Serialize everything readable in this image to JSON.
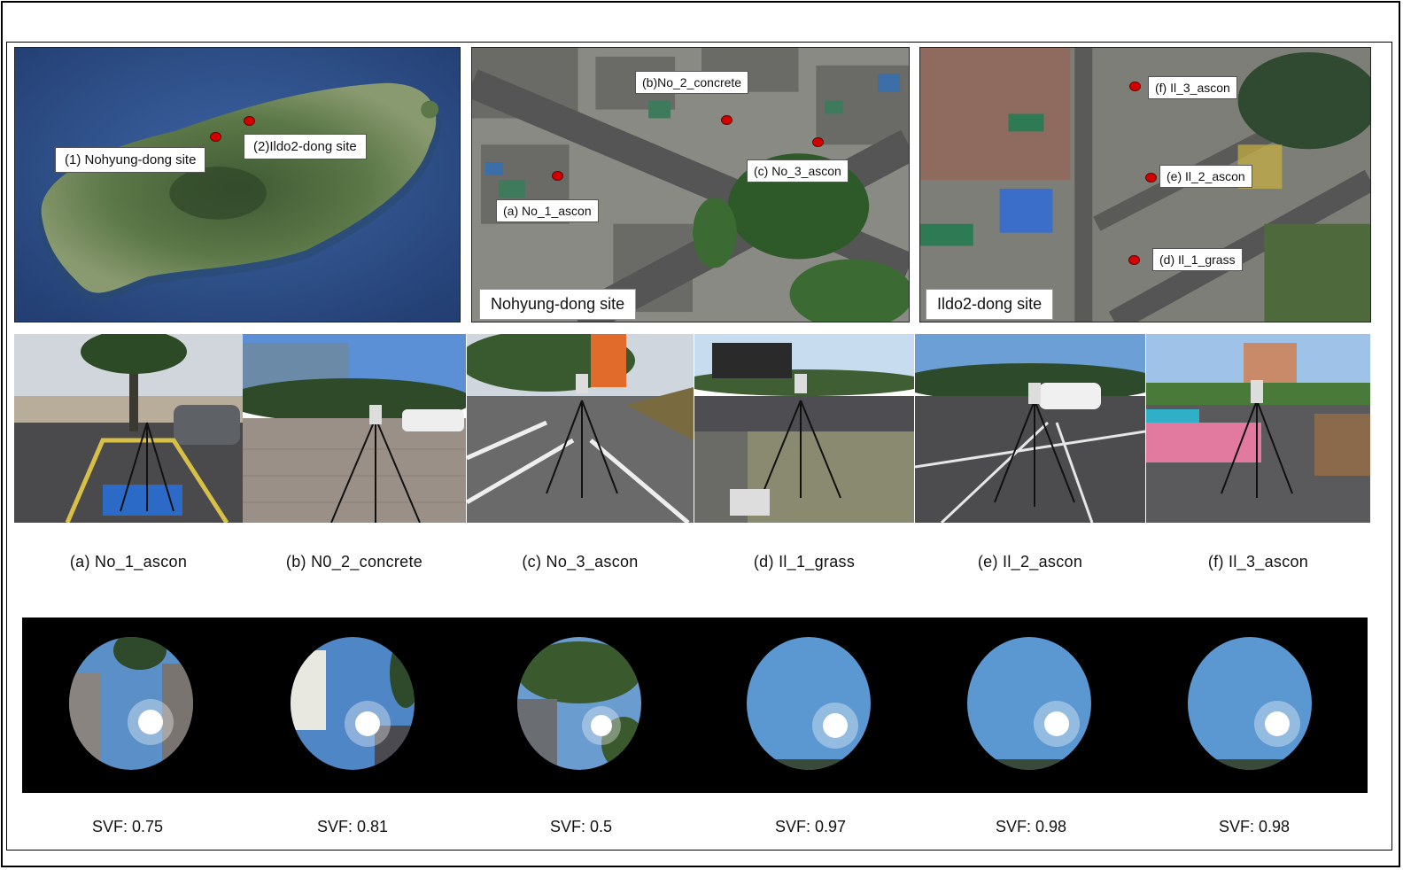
{
  "maps": {
    "island": {
      "label_1": "(1) Nohyung-dong site",
      "label_2": "(2)Ildo2-dong site"
    },
    "nohyung": {
      "site_label": "Nohyung-dong site",
      "labels": [
        "(a) No_1_ascon",
        "(b)No_2_concrete",
        "(c) No_3_ascon"
      ]
    },
    "ildo": {
      "site_label": "Ildo2-dong site",
      "labels": [
        "(d) Il_1_grass",
        "(e) Il_2_ascon",
        "(f) Il_3_ascon"
      ]
    }
  },
  "photos": {
    "captions": [
      "(a) No_1_ascon",
      "(b) N0_2_concrete",
      "(c) No_3_ascon",
      "(d) Il_1_grass",
      "(e) Il_2_ascon",
      "(f) Il_3_ascon"
    ]
  },
  "fisheye": {
    "svf": [
      "SVF: 0.75",
      "SVF: 0.81",
      "SVF: 0.5",
      "SVF: 0.97",
      "SVF: 0.98",
      "SVF: 0.98"
    ]
  },
  "colors": {
    "sea": "#2b4f8a",
    "land": "#5f7a48",
    "marker": "#d40000",
    "sky": "#6fa6d6"
  }
}
